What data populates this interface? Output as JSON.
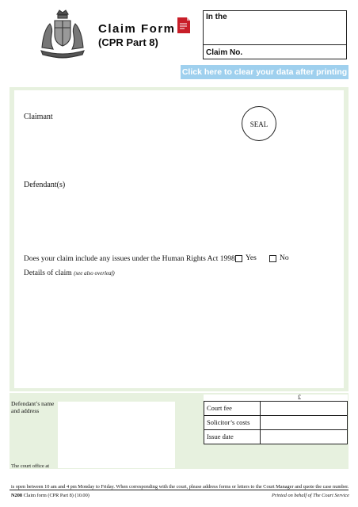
{
  "header": {
    "title": "Claim Form",
    "subtitle": "(CPR Part 8)",
    "in_the_label": "In the",
    "claim_no_label": "Claim No.",
    "clear_button_label": "Click here to clear your data after printing"
  },
  "parties": {
    "claimant_label": "Claimant",
    "defendants_label": "Defendant(s)",
    "seal_label": "SEAL"
  },
  "human_rights": {
    "question": "Does your claim include any issues under the Human Rights Act 1998?",
    "yes_label": "Yes",
    "no_label": "No"
  },
  "details": {
    "label": "Details of claim",
    "note": "(see also overleaf)"
  },
  "defendant_address": {
    "label": "Defendant’s name and address"
  },
  "fees": {
    "currency_symbol": "£",
    "rows": [
      "Court fee",
      "Solicitor’s costs",
      "Issue date"
    ]
  },
  "footer": {
    "court_office_label": "The court office at",
    "opening_hours": "is open between 10 am and 4 pm Monday to Friday.  When corresponding with the court, please address forms or letters to the Court Manager and quote the case number.",
    "form_code": "N208",
    "form_name": "Claim form (CPR Part 8) (10.00)",
    "printed_by": "Printed on behalf of The Court Service"
  },
  "colors": {
    "panel_green": "#e7f1df",
    "button_blue": "#9fd0ee",
    "pdf_red": "#c81e28"
  },
  "icons": {
    "crest": "royal-coat-of-arms-icon",
    "pdf": "pdf-document-icon"
  }
}
